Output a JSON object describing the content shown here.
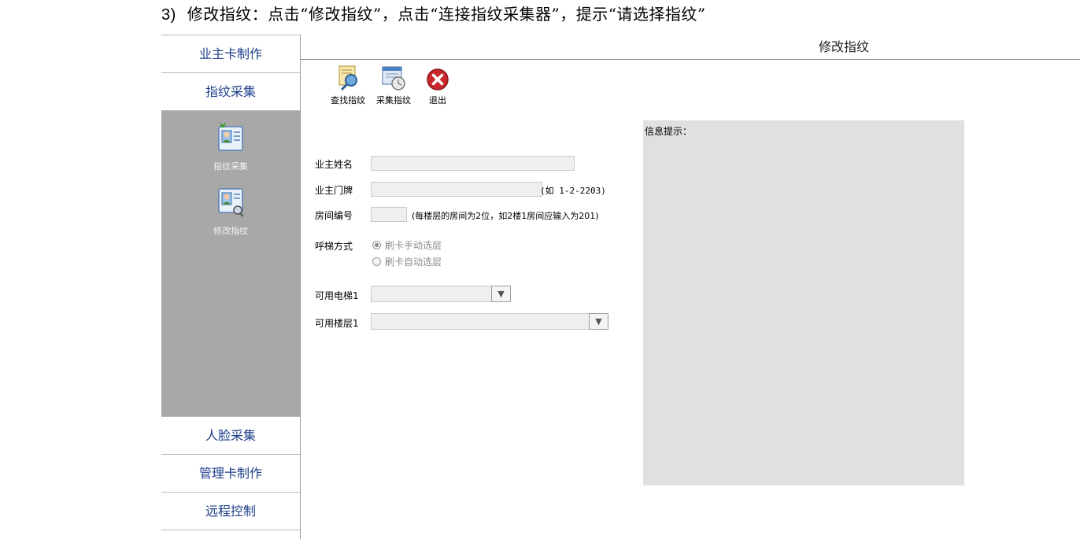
{
  "caption": {
    "number": "3)",
    "text": "修改指纹：点击“修改指纹”，点击“连接指纹采集器”，提示“请选择指纹”"
  },
  "sidebar": {
    "items_top": [
      {
        "label": "业主卡制作"
      },
      {
        "label": "指纹采集"
      }
    ],
    "tools": [
      {
        "label": "指纹采集",
        "icon": "fingerprint-collect-icon"
      },
      {
        "label": "修改指纹",
        "icon": "fingerprint-edit-icon"
      }
    ],
    "items_bottom": [
      {
        "label": "人脸采集"
      },
      {
        "label": "管理卡制作"
      },
      {
        "label": "远程控制"
      }
    ]
  },
  "main": {
    "title": "修改指纹",
    "toolbar": {
      "find": "查找指纹",
      "collect": "采集指纹",
      "exit": "退出"
    },
    "form": {
      "owner_name_label": "业主姓名",
      "owner_name_value": "",
      "owner_door_label": "业主门牌",
      "owner_door_value": "",
      "owner_door_hint": "(如 1-2-2203)",
      "room_no_label": "房间编号",
      "room_no_value": "",
      "room_no_hint": "(每楼层的房间为2位，如2楼1房间应输入为201)",
      "call_mode_label": "呼梯方式",
      "call_mode_options": [
        {
          "label": "刷卡手动选层",
          "selected": true
        },
        {
          "label": "刷卡自动选层",
          "selected": false
        }
      ],
      "elevator_label": "可用电梯1",
      "elevator_value": "",
      "floor_label": "可用楼层1",
      "floor_value": ""
    },
    "info_panel_title": "信息提示："
  },
  "colors": {
    "sidebar_text": "#1e3f8a",
    "sidebar_panel": "#a8a8a8",
    "info_panel": "#e0e0e0"
  }
}
